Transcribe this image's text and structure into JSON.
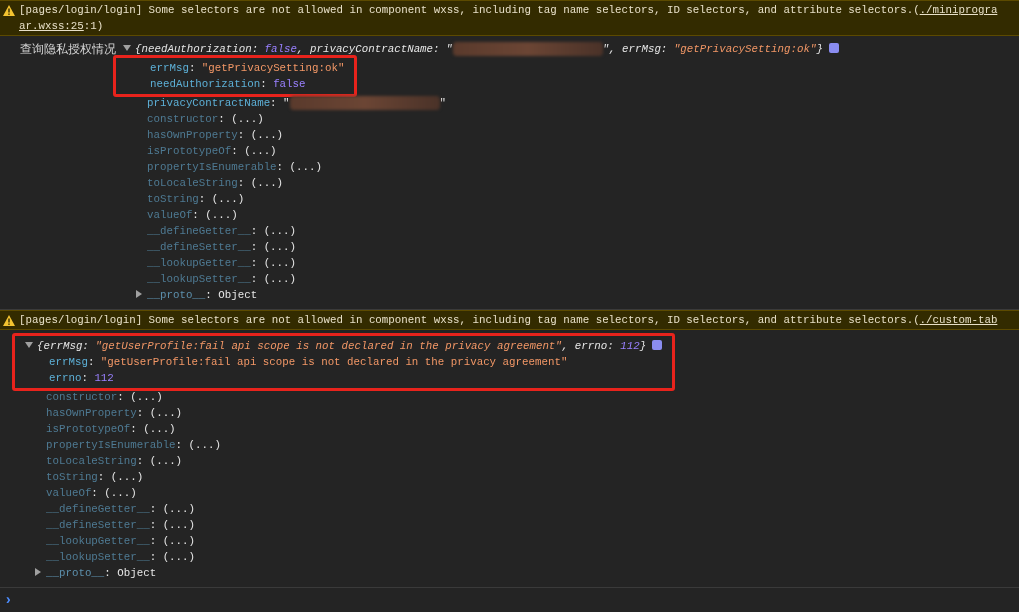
{
  "syntax": {
    "colon": ":",
    "open_brace": "{",
    "close_brace": "}",
    "comma": ","
  },
  "messages": [
    {
      "kind": "warning",
      "text": "[pages/login/login] Some selectors are not allowed in component wxss, including tag name selectors, ID selectors, and attribute selectors.(",
      "link": "./miniprogra",
      "continuation_link": "ar.wxss:25",
      "continuation_tail": ":1)"
    },
    {
      "kind": "log",
      "label": "查询隐私授权情况",
      "expanded": true,
      "preview_highlighted": false,
      "preview": [
        {
          "key": "needAuthorization",
          "kind": "bool",
          "value": "false"
        },
        {
          "key": "privacyContractName",
          "kind": "redacted",
          "open": "\"",
          "close": "\""
        },
        {
          "key": "errMsg",
          "kind": "string",
          "value": "\"getPrivacySetting:ok\""
        }
      ],
      "properties": [
        {
          "key": "errMsg",
          "kind": "string",
          "value": "\"getPrivacySetting:ok\"",
          "highlighted": true
        },
        {
          "key": "needAuthorization",
          "kind": "bool",
          "value": "false",
          "highlighted": true
        },
        {
          "key": "privacyContractName",
          "kind": "redacted",
          "open": "\"",
          "close": "\"",
          "highlighted": false
        },
        {
          "key": "constructor",
          "kind": "getter",
          "value": "(...)",
          "highlighted": false
        },
        {
          "key": "hasOwnProperty",
          "kind": "getter",
          "value": "(...)",
          "highlighted": false
        },
        {
          "key": "isPrototypeOf",
          "kind": "getter",
          "value": "(...)",
          "highlighted": false
        },
        {
          "key": "propertyIsEnumerable",
          "kind": "getter",
          "value": "(...)",
          "highlighted": false
        },
        {
          "key": "toLocaleString",
          "kind": "getter",
          "value": "(...)",
          "highlighted": false
        },
        {
          "key": "toString",
          "kind": "getter",
          "value": "(...)",
          "highlighted": false
        },
        {
          "key": "valueOf",
          "kind": "getter",
          "value": "(...)",
          "highlighted": false
        },
        {
          "key": "__defineGetter__",
          "kind": "getter",
          "value": "(...)",
          "highlighted": false
        },
        {
          "key": "__defineSetter__",
          "kind": "getter",
          "value": "(...)",
          "highlighted": false
        },
        {
          "key": "__lookupGetter__",
          "kind": "getter",
          "value": "(...)",
          "highlighted": false
        },
        {
          "key": "__lookupSetter__",
          "kind": "getter",
          "value": "(...)",
          "highlighted": false
        },
        {
          "key": "__proto__",
          "kind": "proto",
          "value": "Object",
          "highlighted": false,
          "expanded": false
        }
      ]
    },
    {
      "kind": "warning",
      "text": "[pages/login/login] Some selectors are not allowed in component wxss, including tag name selectors, ID selectors, and attribute selectors.(",
      "link": "./custom-tab"
    },
    {
      "kind": "log",
      "expanded": true,
      "preview_highlighted": true,
      "preview": [
        {
          "key": "errMsg",
          "kind": "string",
          "value": "\"getUserProfile:fail api scope is not declared in the privacy agreement\""
        },
        {
          "key": "errno",
          "kind": "number",
          "value": "112"
        }
      ],
      "properties": [
        {
          "key": "errMsg",
          "kind": "string",
          "value": "\"getUserProfile:fail api scope is not declared in the privacy agreement\"",
          "highlighted": true
        },
        {
          "key": "errno",
          "kind": "number",
          "value": "112",
          "highlighted": true
        },
        {
          "key": "constructor",
          "kind": "getter",
          "value": "(...)",
          "highlighted": false
        },
        {
          "key": "hasOwnProperty",
          "kind": "getter",
          "value": "(...)",
          "highlighted": false
        },
        {
          "key": "isPrototypeOf",
          "kind": "getter",
          "value": "(...)",
          "highlighted": false
        },
        {
          "key": "propertyIsEnumerable",
          "kind": "getter",
          "value": "(...)",
          "highlighted": false
        },
        {
          "key": "toLocaleString",
          "kind": "getter",
          "value": "(...)",
          "highlighted": false
        },
        {
          "key": "toString",
          "kind": "getter",
          "value": "(...)",
          "highlighted": false
        },
        {
          "key": "valueOf",
          "kind": "getter",
          "value": "(...)",
          "highlighted": false
        },
        {
          "key": "__defineGetter__",
          "kind": "getter",
          "value": "(...)",
          "highlighted": false
        },
        {
          "key": "__defineSetter__",
          "kind": "getter",
          "value": "(...)",
          "highlighted": false
        },
        {
          "key": "__lookupGetter__",
          "kind": "getter",
          "value": "(...)",
          "highlighted": false
        },
        {
          "key": "__lookupSetter__",
          "kind": "getter",
          "value": "(...)",
          "highlighted": false
        },
        {
          "key": "__proto__",
          "kind": "proto",
          "value": "Object",
          "highlighted": false,
          "expanded": false
        }
      ]
    }
  ],
  "prompt": {
    "symbol": "›"
  }
}
